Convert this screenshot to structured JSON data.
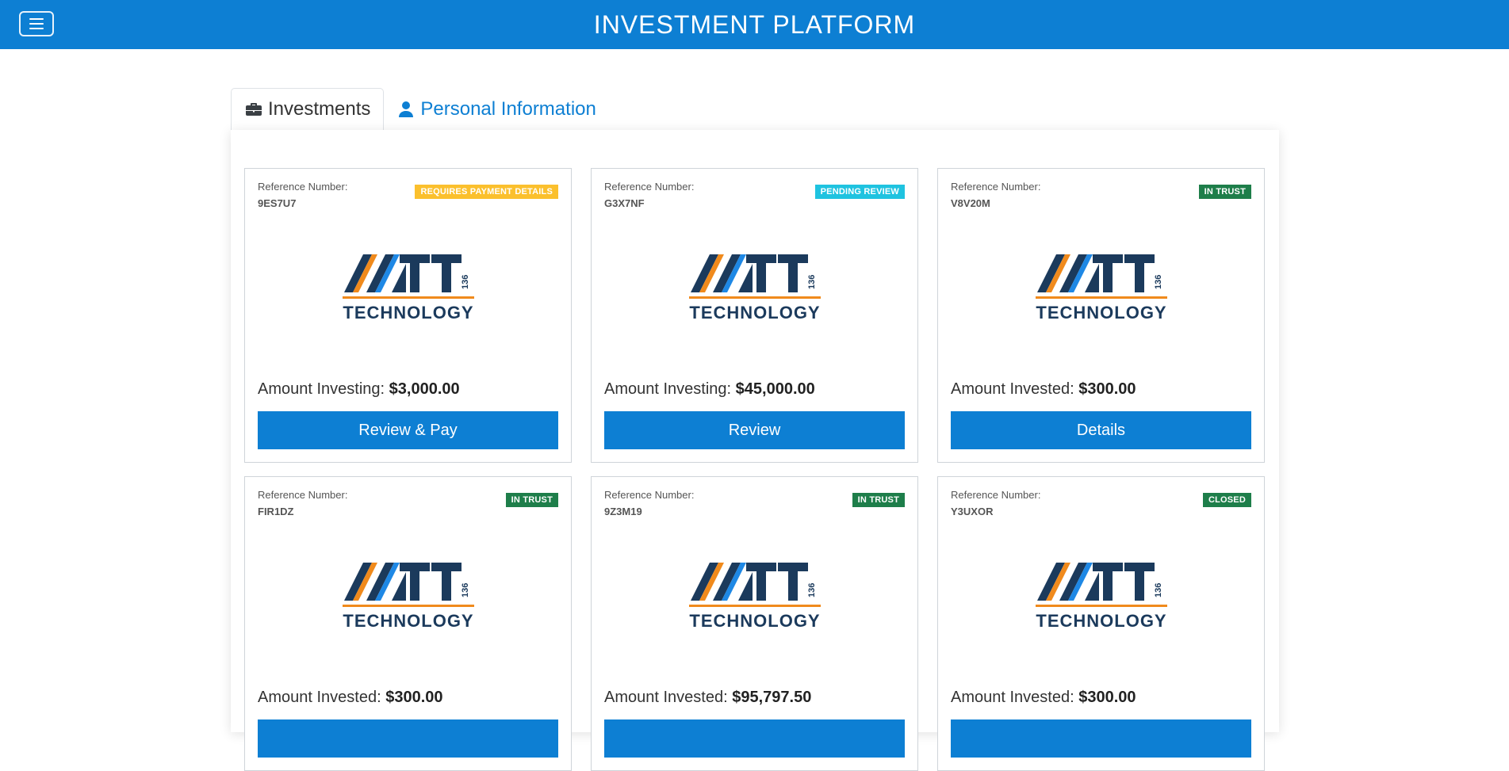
{
  "header": {
    "title": "INVESTMENT PLATFORM",
    "menu_icon": "hamburger-menu-icon",
    "background_color": "#0d7fd3"
  },
  "tabs": [
    {
      "label": "Investments",
      "icon": "briefcase-icon",
      "active": true
    },
    {
      "label": "Personal Information",
      "icon": "user-icon",
      "active": false
    }
  ],
  "investments": [
    {
      "ref_label": "Reference Number:",
      "ref": "9ES7U7",
      "status": "REQUIRES PAYMENT DETAILS",
      "status_color": "#fbc02d",
      "amount_label": "Amount Investing:",
      "amount": "$3,000.00",
      "action": "Review & Pay",
      "logo": {
        "mark": "MTT",
        "sub": "136",
        "word": "TECHNOLOGY"
      }
    },
    {
      "ref_label": "Reference Number:",
      "ref": "G3X7NF",
      "status": "PENDING REVIEW",
      "status_color": "#1fc3e0",
      "amount_label": "Amount Investing:",
      "amount": "$45,000.00",
      "action": "Review",
      "logo": {
        "mark": "MTT",
        "sub": "136",
        "word": "TECHNOLOGY"
      }
    },
    {
      "ref_label": "Reference Number:",
      "ref": "V8V20M",
      "status": "IN TRUST",
      "status_color": "#1e7e4a",
      "amount_label": "Amount Invested:",
      "amount": "$300.00",
      "action": "Details",
      "logo": {
        "mark": "MTT",
        "sub": "136",
        "word": "TECHNOLOGY"
      }
    },
    {
      "ref_label": "Reference Number:",
      "ref": "FIR1DZ",
      "status": "IN TRUST",
      "status_color": "#1e7e4a",
      "amount_label": "Amount Invested:",
      "amount": "$300.00",
      "action": "",
      "logo": {
        "mark": "MTT",
        "sub": "136",
        "word": "TECHNOLOGY"
      }
    },
    {
      "ref_label": "Reference Number:",
      "ref": "9Z3M19",
      "status": "IN TRUST",
      "status_color": "#1e7e4a",
      "amount_label": "Amount Invested:",
      "amount": "$95,797.50",
      "action": "",
      "logo": {
        "mark": "MTT",
        "sub": "136",
        "word": "TECHNOLOGY"
      }
    },
    {
      "ref_label": "Reference Number:",
      "ref": "Y3UXOR",
      "status": "CLOSED",
      "status_color": "#1e7e4a",
      "amount_label": "Amount Invested:",
      "amount": "$300.00",
      "action": "",
      "logo": {
        "mark": "MTT",
        "sub": "136",
        "word": "TECHNOLOGY"
      }
    }
  ]
}
